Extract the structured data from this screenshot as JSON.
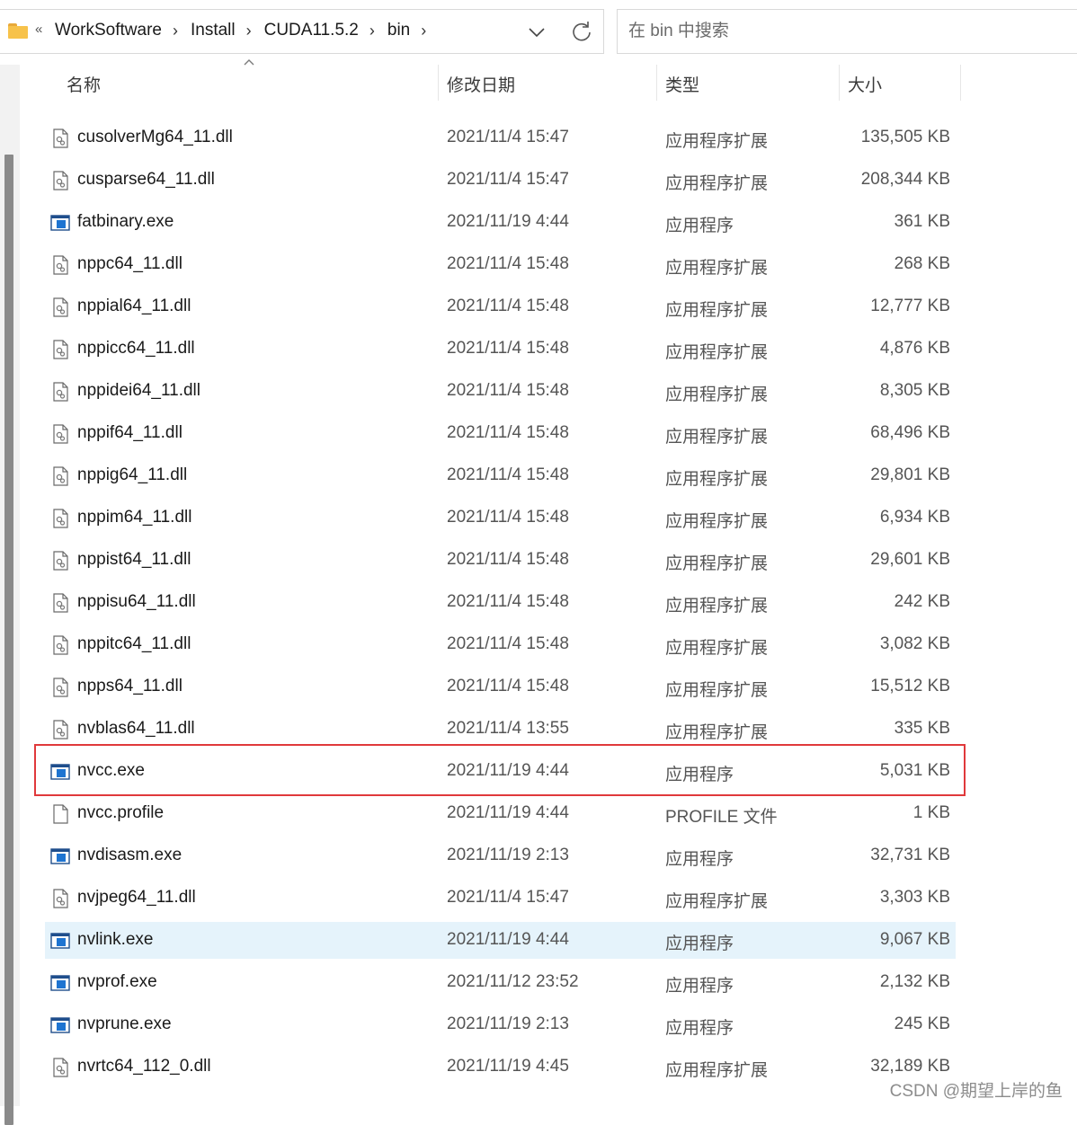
{
  "address_bar": {
    "overflow_label": "«",
    "breadcrumbs": [
      "WorkSoftware",
      "Install",
      "CUDA11.5.2",
      "bin"
    ]
  },
  "search": {
    "placeholder": "在 bin 中搜索"
  },
  "columns": {
    "name": "名称",
    "date": "修改日期",
    "type": "类型",
    "size": "大小"
  },
  "files": [
    {
      "name": "cusolverMg64_11.dll",
      "date": "2021/11/4 15:47",
      "type": "应用程序扩展",
      "size": "135,505 KB",
      "icon": "dll-file-icon"
    },
    {
      "name": "cusparse64_11.dll",
      "date": "2021/11/4 15:47",
      "type": "应用程序扩展",
      "size": "208,344 KB",
      "icon": "dll-file-icon"
    },
    {
      "name": "fatbinary.exe",
      "date": "2021/11/19 4:44",
      "type": "应用程序",
      "size": "361 KB",
      "icon": "exe-file-icon"
    },
    {
      "name": "nppc64_11.dll",
      "date": "2021/11/4 15:48",
      "type": "应用程序扩展",
      "size": "268 KB",
      "icon": "dll-file-icon"
    },
    {
      "name": "nppial64_11.dll",
      "date": "2021/11/4 15:48",
      "type": "应用程序扩展",
      "size": "12,777 KB",
      "icon": "dll-file-icon"
    },
    {
      "name": "nppicc64_11.dll",
      "date": "2021/11/4 15:48",
      "type": "应用程序扩展",
      "size": "4,876 KB",
      "icon": "dll-file-icon"
    },
    {
      "name": "nppidei64_11.dll",
      "date": "2021/11/4 15:48",
      "type": "应用程序扩展",
      "size": "8,305 KB",
      "icon": "dll-file-icon"
    },
    {
      "name": "nppif64_11.dll",
      "date": "2021/11/4 15:48",
      "type": "应用程序扩展",
      "size": "68,496 KB",
      "icon": "dll-file-icon"
    },
    {
      "name": "nppig64_11.dll",
      "date": "2021/11/4 15:48",
      "type": "应用程序扩展",
      "size": "29,801 KB",
      "icon": "dll-file-icon"
    },
    {
      "name": "nppim64_11.dll",
      "date": "2021/11/4 15:48",
      "type": "应用程序扩展",
      "size": "6,934 KB",
      "icon": "dll-file-icon"
    },
    {
      "name": "nppist64_11.dll",
      "date": "2021/11/4 15:48",
      "type": "应用程序扩展",
      "size": "29,601 KB",
      "icon": "dll-file-icon"
    },
    {
      "name": "nppisu64_11.dll",
      "date": "2021/11/4 15:48",
      "type": "应用程序扩展",
      "size": "242 KB",
      "icon": "dll-file-icon"
    },
    {
      "name": "nppitc64_11.dll",
      "date": "2021/11/4 15:48",
      "type": "应用程序扩展",
      "size": "3,082 KB",
      "icon": "dll-file-icon"
    },
    {
      "name": "npps64_11.dll",
      "date": "2021/11/4 15:48",
      "type": "应用程序扩展",
      "size": "15,512 KB",
      "icon": "dll-file-icon"
    },
    {
      "name": "nvblas64_11.dll",
      "date": "2021/11/4 13:55",
      "type": "应用程序扩展",
      "size": "335 KB",
      "icon": "dll-file-icon"
    },
    {
      "name": "nvcc.exe",
      "date": "2021/11/19 4:44",
      "type": "应用程序",
      "size": "5,031 KB",
      "icon": "exe-file-icon"
    },
    {
      "name": "nvcc.profile",
      "date": "2021/11/19 4:44",
      "type": "PROFILE 文件",
      "size": "1 KB",
      "icon": "blank-file-icon"
    },
    {
      "name": "nvdisasm.exe",
      "date": "2021/11/19 2:13",
      "type": "应用程序",
      "size": "32,731 KB",
      "icon": "exe-file-icon"
    },
    {
      "name": "nvjpeg64_11.dll",
      "date": "2021/11/4 15:47",
      "type": "应用程序扩展",
      "size": "3,303 KB",
      "icon": "dll-file-icon"
    },
    {
      "name": "nvlink.exe",
      "date": "2021/11/19 4:44",
      "type": "应用程序",
      "size": "9,067 KB",
      "icon": "exe-file-icon",
      "selected": true
    },
    {
      "name": "nvprof.exe",
      "date": "2021/11/12 23:52",
      "type": "应用程序",
      "size": "2,132 KB",
      "icon": "exe-file-icon"
    },
    {
      "name": "nvprune.exe",
      "date": "2021/11/19 2:13",
      "type": "应用程序",
      "size": "245 KB",
      "icon": "exe-file-icon"
    },
    {
      "name": "nvrtc64_112_0.dll",
      "date": "2021/11/19 4:45",
      "type": "应用程序扩展",
      "size": "32,189 KB",
      "icon": "dll-file-icon"
    }
  ],
  "watermark": "CSDN @期望上岸的鱼",
  "colors": {
    "selection": "#e5f3fb",
    "highlight_border": "#e0393b",
    "folder": "#f7c24a",
    "exe_blue": "#1e74d1"
  }
}
